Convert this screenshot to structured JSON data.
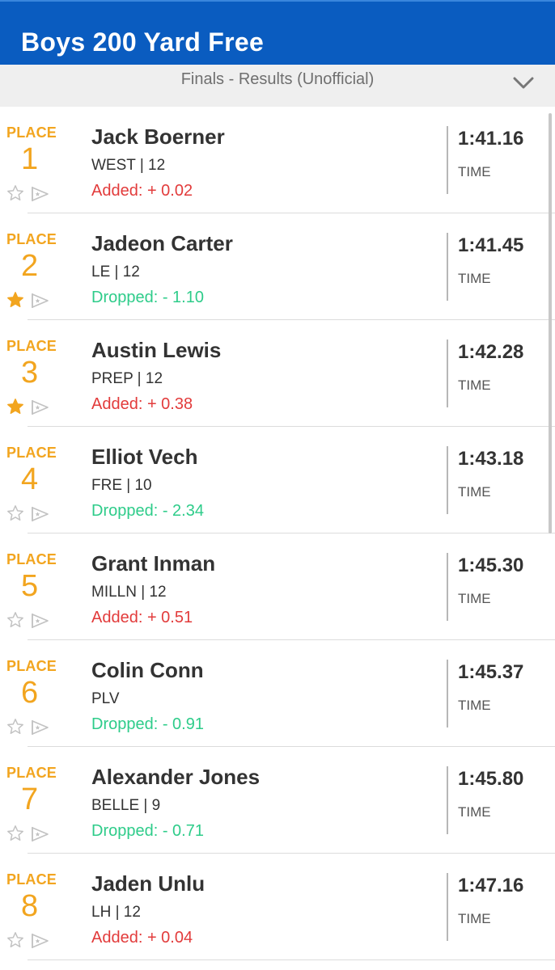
{
  "header": {
    "title": "Boys 200 Yard Free"
  },
  "subbar": {
    "subtitle": "Finals - Results (Unofficial)"
  },
  "colors": {
    "header_blue": "#0a5cc0",
    "place_orange": "#f2a51f",
    "added_red": "#e23b3b",
    "dropped_green": "#2ecc8a"
  },
  "results": [
    {
      "place_label": "PLACE",
      "place": "1",
      "name": "Jack Boerner",
      "team": "WEST | 12",
      "delta": "Added: + 0.02",
      "delta_type": "added",
      "time": "1:41.16",
      "time_label": "TIME",
      "starred": false
    },
    {
      "place_label": "PLACE",
      "place": "2",
      "name": "Jadeon Carter",
      "team": "LE | 12",
      "delta": "Dropped: - 1.10",
      "delta_type": "dropped",
      "time": "1:41.45",
      "time_label": "TIME",
      "starred": true
    },
    {
      "place_label": "PLACE",
      "place": "3",
      "name": "Austin Lewis",
      "team": "PREP | 12",
      "delta": "Added: + 0.38",
      "delta_type": "added",
      "time": "1:42.28",
      "time_label": "TIME",
      "starred": true
    },
    {
      "place_label": "PLACE",
      "place": "4",
      "name": "Elliot Vech",
      "team": "FRE | 10",
      "delta": "Dropped: - 2.34",
      "delta_type": "dropped",
      "time": "1:43.18",
      "time_label": "TIME",
      "starred": false
    },
    {
      "place_label": "PLACE",
      "place": "5",
      "name": "Grant Inman",
      "team": "MILLN | 12",
      "delta": "Added: + 0.51",
      "delta_type": "added",
      "time": "1:45.30",
      "time_label": "TIME",
      "starred": false
    },
    {
      "place_label": "PLACE",
      "place": "6",
      "name": "Colin Conn",
      "team": "PLV",
      "delta": "Dropped: - 0.91",
      "delta_type": "dropped",
      "time": "1:45.37",
      "time_label": "TIME",
      "starred": false
    },
    {
      "place_label": "PLACE",
      "place": "7",
      "name": "Alexander Jones",
      "team": "BELLE | 9",
      "delta": "Dropped: - 0.71",
      "delta_type": "dropped",
      "time": "1:45.80",
      "time_label": "TIME",
      "starred": false
    },
    {
      "place_label": "PLACE",
      "place": "8",
      "name": "Jaden Unlu",
      "team": "LH | 12",
      "delta": "Added: + 0.04",
      "delta_type": "added",
      "time": "1:47.16",
      "time_label": "TIME",
      "starred": false
    }
  ]
}
